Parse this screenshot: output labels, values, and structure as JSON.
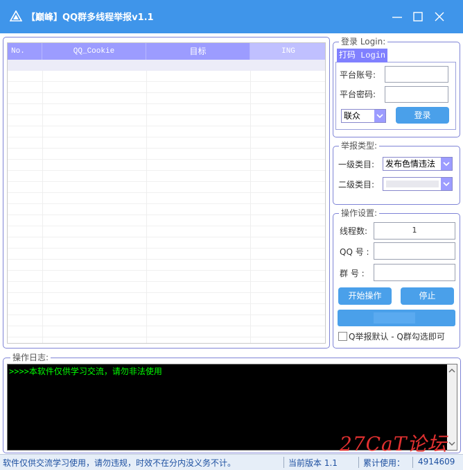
{
  "window": {
    "title": "【巅峰】QQ群多线程举报v1.1",
    "accent": "#3f95ea"
  },
  "grid": {
    "columns": [
      "No.",
      "QQ_Cookie",
      "目标",
      "ING"
    ],
    "rows": []
  },
  "login": {
    "group_title": "登录 Login:",
    "tab_label": "打码 Login",
    "account_label": "平台账号:",
    "account_value": "",
    "password_label": "平台密码:",
    "password_value": "",
    "platform_selected": "联众",
    "login_button": "登录"
  },
  "report_type": {
    "group_title": "举报类型:",
    "level1_label": "一级类目:",
    "level1_selected": "发布色情违法",
    "level2_label": "二级类目:",
    "level2_selected": ""
  },
  "operation": {
    "group_title": "操作设置:",
    "threads_label": "线程数:",
    "threads_value": "1",
    "qq_label": "QQ 号 :",
    "qq_value": "",
    "group_label": "群 号 :",
    "group_value": "",
    "start_button": "开始操作",
    "stop_button": "停止",
    "checkbox_label": "Q举报默认 - Q群勾选即可",
    "checkbox_checked": false
  },
  "log": {
    "group_title": "操作日志:",
    "lines": [
      ">>>>本软件仅供学习交流，请勿非法使用"
    ]
  },
  "status_bar": {
    "disclaimer": "软件仅供交流学习使用，请勿违规，时效不在分内没义务不计。",
    "version": "当前版本 1.1",
    "usage_label": "累计使用：",
    "usage_count": "4914609"
  },
  "watermark": {
    "text": "27CaT论坛",
    "color": "#e03030"
  }
}
